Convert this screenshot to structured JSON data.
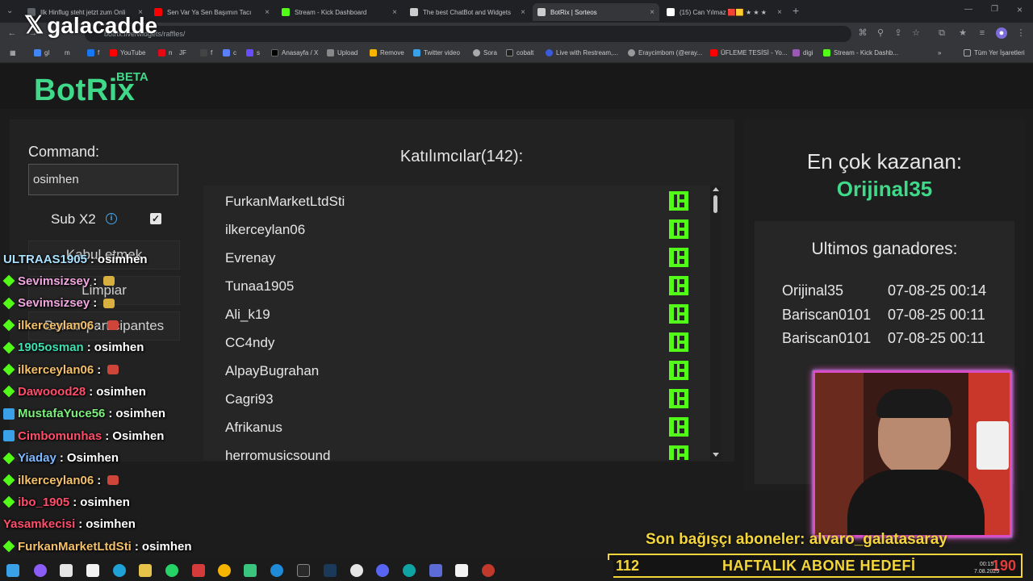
{
  "browser": {
    "tabs": [
      {
        "title": "Ilk Hinflug steht jetzt zum Onli",
        "color": "#5f6368"
      },
      {
        "title": "Sen Var Ya Sen Başımın Tacı",
        "color": "#ff0000"
      },
      {
        "title": "Stream - Kick Dashboard",
        "color": "#53fc18"
      },
      {
        "title": "The best ChatBot and Widgets",
        "color": "#cccccc"
      },
      {
        "title": "BotRix | Sorteos",
        "color": "#cccccc"
      },
      {
        "title": "(15) Can Yılmaz 🟥🟨 ★ ★ ★",
        "color": "#ffffff"
      }
    ],
    "url": "botrix.live/widgets/raffles/",
    "bookmarks": [
      "gl",
      "m",
      "f",
      "YouTube",
      "n",
      "JF",
      "f",
      "c",
      "s",
      "Anasayfa / X",
      "Upload",
      "Remove",
      "Twitter video",
      "Sora",
      "cobalt",
      "Live with Restream,...",
      "Eraycimbom (@eray...",
      "ÜFLEME TESİSİ - Yo...",
      "digi",
      "Stream - Kick Dashb..."
    ],
    "bookmarks_other": "Tüm Yer İşaretleri"
  },
  "watermark": "galacadde",
  "brand": {
    "name": "BotRix",
    "badge": "BETA"
  },
  "command": {
    "label": "Command:",
    "value": "osimhen"
  },
  "sub": {
    "label": "Sub X2",
    "checked": "✓",
    "info": "i"
  },
  "buttons": {
    "stop": "Kabul etmek",
    "clear": "Limpiar",
    "participants": "Borrar participantes"
  },
  "participants": {
    "title": "Katılımcılar(142):",
    "names": [
      "FurkanMarketLtdSti",
      "ilkerceylan06",
      "Evrenay",
      "Tunaa1905",
      "Ali_k19",
      "CC4ndy",
      "AlpayBugrahan",
      "Cagri93",
      "Afrikanus",
      "herromusicsound"
    ]
  },
  "top_winner": {
    "label": "En çok kazanan:",
    "name": "Orijinal35"
  },
  "recent_winners": {
    "title": "Ultimos ganadores:",
    "rows": [
      {
        "name": "Orijinal35",
        "time": "07-08-25 00:14"
      },
      {
        "name": "Bariscan0101",
        "time": "07-08-25 00:11"
      },
      {
        "name": "Bariscan0101",
        "time": "07-08-25 00:11"
      }
    ]
  },
  "chat": [
    {
      "user": "ULTRAAS1905",
      "msg": "osimhen",
      "color": "#a9e2ff",
      "badge": ""
    },
    {
      "user": "Sevimsizsey",
      "msg": "",
      "color": "#f2a6e0",
      "badge": "green",
      "emote": "#d8b040"
    },
    {
      "user": "Sevimsizsey",
      "msg": "",
      "color": "#f2a6e0",
      "badge": "green",
      "emote": "#d8b040"
    },
    {
      "user": "ilkerceylan06",
      "msg": "",
      "color": "#f4c069",
      "badge": "green",
      "emote": "#d0453a"
    },
    {
      "user": "1905osman",
      "msg": "osimhen",
      "color": "#3ee0b0",
      "badge": "green"
    },
    {
      "user": "ilkerceylan06",
      "msg": "",
      "color": "#f4c069",
      "badge": "green",
      "emote": "#d0453a"
    },
    {
      "user": "Dawoood28",
      "msg": "osimhen",
      "color": "#ff4d6a",
      "badge": "green"
    },
    {
      "user": "MustafaYuce56",
      "msg": "osimhen",
      "color": "#7cf07c",
      "badge": "blue"
    },
    {
      "user": "Cimbomunhas",
      "msg": "Osimhen",
      "color": "#ff4d6a",
      "badge": "blue"
    },
    {
      "user": "Yiaday",
      "msg": "Osimhen",
      "color": "#7fb8ff",
      "badge": "green"
    },
    {
      "user": "ilkerceylan06",
      "msg": "",
      "color": "#f4c069",
      "badge": "green",
      "emote": "#d0453a"
    },
    {
      "user": "ibo_1905",
      "msg": "osimhen",
      "color": "#ff4d6a",
      "badge": "green"
    },
    {
      "user": "Yasamkecisi",
      "msg": "osimhen",
      "color": "#ff4d6a",
      "badge": ""
    },
    {
      "user": "FurkanMarketLtdSti",
      "msg": "osimhen",
      "color": "#f4c069",
      "badge": "green"
    }
  ],
  "donation": {
    "last_donor": "Son bağışçı aboneler: alvaro_galatasaray",
    "goal_current": "112",
    "goal_label": "HAFTALIK ABONE HEDEFİ",
    "goal_target": "190"
  },
  "clock": {
    "time": "00:15",
    "date": "7.08.2025"
  },
  "colors": {
    "accent": "#40d98a",
    "kick": "#53fc18",
    "goal": "#f4d63b"
  }
}
